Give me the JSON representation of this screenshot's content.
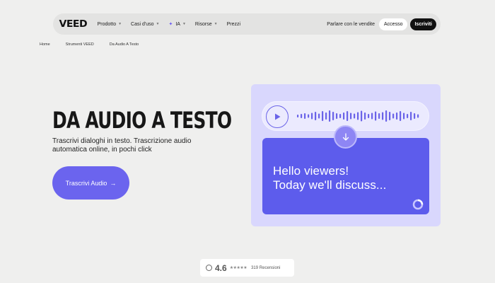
{
  "nav": {
    "logo": "VEED",
    "links": [
      {
        "label": "Prodotto",
        "dropdown": true
      },
      {
        "label": "Casi d'uso",
        "dropdown": true
      },
      {
        "label": "IA",
        "dropdown": true
      },
      {
        "label": "Risorse",
        "dropdown": true
      },
      {
        "label": "Prezzi",
        "dropdown": false
      }
    ],
    "sales_label": "Parlare con le vendite",
    "login_label": "Accesso",
    "signup_label": "Iscriviti"
  },
  "breadcrumb": [
    "Home",
    "Strumenti VEED",
    "Da Audio A Testo"
  ],
  "hero": {
    "title": "DA AUDIO A TESTO",
    "subtitle": "Trascrivi dialoghi in testo. Trascrizione audio automatica online, in pochi click",
    "cta_label": "Trascrivi Audio",
    "cta_arrow": "→"
  },
  "illustration": {
    "transcript_line1": "Hello viewers!",
    "transcript_line2": "Today we'll discuss..."
  },
  "rating": {
    "score": "4.6",
    "stars": "★★★★★",
    "reviews": "319 Recensioni"
  },
  "colors": {
    "accent": "#6b64ee",
    "card_bg": "#d9d7fd",
    "transcript_bg": "#5d5cec"
  }
}
